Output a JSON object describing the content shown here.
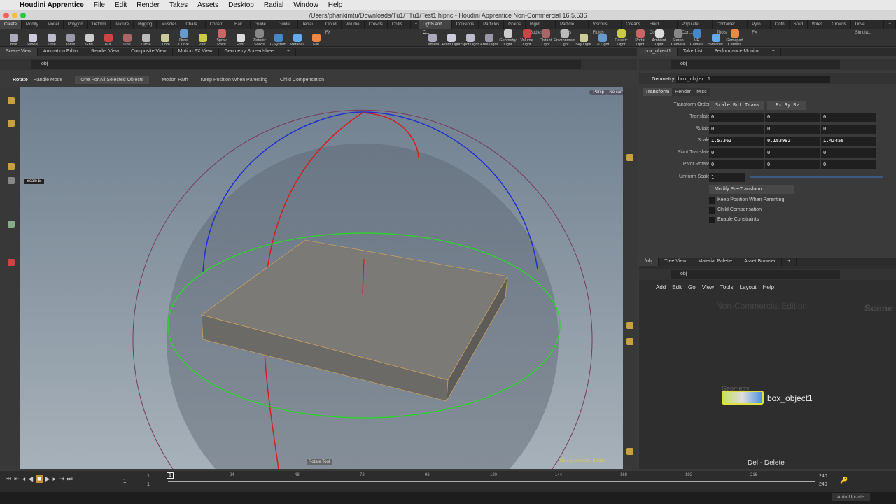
{
  "menubar": {
    "app": "Houdini Apprentice",
    "items": [
      "File",
      "Edit",
      "Render",
      "Takes",
      "Assets",
      "Desktop",
      "Radial",
      "Window",
      "Help"
    ]
  },
  "window_title": "/Users/phankimtu/Downloads/Tu1/TTu1/Test1.hipnc - Houdini Apprentice Non-Commercial 16.5.536",
  "shelf_left": {
    "tabs": [
      "Create",
      "Modify",
      "Model",
      "Polygon",
      "Deform",
      "Texture",
      "Rigging",
      "Muscles",
      "Chara...",
      "Constr...",
      "Hair...",
      "Guide...",
      "Guide...",
      "Terrai...",
      "Cloud FX",
      "Volume",
      "Crowds",
      "Collis..."
    ],
    "tools": [
      "Box",
      "Sphere",
      "Tube",
      "Torus",
      "Grid",
      "Null",
      "Line",
      "Circle",
      "Curve",
      "Draw Curve",
      "Path",
      "Spray Paint",
      "Font",
      "Platonic Solids",
      "L-System",
      "Metaball",
      "File"
    ]
  },
  "shelf_right": {
    "tabs": [
      "Lights and C...",
      "Collisions",
      "Particles",
      "Grains",
      "Rigid Bodies",
      "Particle Fluids",
      "Viscous Fluids",
      "Oceans",
      "Fluid Contai...",
      "Populate Con...",
      "Container Tools",
      "Pyro FX",
      "Cloth",
      "Solid",
      "Wires",
      "Crowds",
      "Drive Simula..."
    ],
    "tools": [
      "Camera",
      "Point Light",
      "Spot Light",
      "Area Light",
      "Geometry Light",
      "Volume Light",
      "Distant Light",
      "Environment Light",
      "Sky Light",
      "GI Light",
      "Caustic Light",
      "Portal Light",
      "Ambient Light",
      "Stereo Camera",
      "VR Camera",
      "Switcher",
      "Gamepad Camera"
    ]
  },
  "left_panes": {
    "tabs": [
      "Scene View",
      "Animation Editor",
      "Render View",
      "Composite View",
      "Motion FX View",
      "Geometry Spreadsheet"
    ],
    "path": "obj"
  },
  "opbar": {
    "tool": "Rotate",
    "handle_mode_label": "Handle Mode",
    "handle_mode": "One For All Selected Objects",
    "options": [
      "Motion Path",
      "Keep Position When Parenting",
      "Child Compensation"
    ]
  },
  "viewport": {
    "camera_menu": "Persp",
    "cam_menu": "No cam",
    "tooltip": "Scale",
    "tooltip_key": "E",
    "status": "Rotate Tool",
    "watermark": "Non-Commercial Edition"
  },
  "params": {
    "tabs_top": [
      "box_object1",
      "Take List",
      "Performance Monitor"
    ],
    "path": "obj",
    "type": "Geometry",
    "name": "box_object1",
    "tabs": [
      "Transform",
      "Render",
      "Misc"
    ],
    "transform_order_label": "Transform Order",
    "transform_order": "Scale Rot Trans",
    "rot_order": "Rx Ry Rz",
    "rows": [
      {
        "label": "Translate",
        "values": [
          "0",
          "0",
          "0"
        ]
      },
      {
        "label": "Rotate",
        "values": [
          "0",
          "0",
          "0"
        ]
      },
      {
        "label": "Scale",
        "values": [
          "1.57363",
          "0.183993",
          "1.43458"
        ]
      },
      {
        "label": "Pivot Translate",
        "values": [
          "0",
          "0",
          "0"
        ]
      },
      {
        "label": "Pivot Rotate",
        "values": [
          "0",
          "0",
          "0"
        ]
      }
    ],
    "uniform_scale_label": "Uniform Scale",
    "uniform_scale": "1",
    "modify": "Modify Pre-Transform",
    "checks": [
      "Keep Position When Parenting",
      "Child Compensation",
      "Enable Constraints"
    ]
  },
  "network": {
    "tabs": [
      "/obj",
      "Tree View",
      "Material Palette",
      "Asset Browser"
    ],
    "path": "obj",
    "menu": [
      "Add",
      "Edit",
      "Go",
      "View",
      "Tools",
      "Layout",
      "Help"
    ],
    "watermark": "Non-Commercial Edition",
    "context": "Scene",
    "node_type": "Geometry",
    "node_name": "box_object1",
    "hint": "Del - Delete"
  },
  "timeline": {
    "frame": "1",
    "start": "1",
    "start2": "1",
    "end": "240",
    "end2": "240",
    "ticks": [
      "24",
      "48",
      "72",
      "96",
      "120",
      "144",
      "168",
      "192",
      "216"
    ]
  },
  "status": {
    "auto_update": "Auto Update"
  }
}
